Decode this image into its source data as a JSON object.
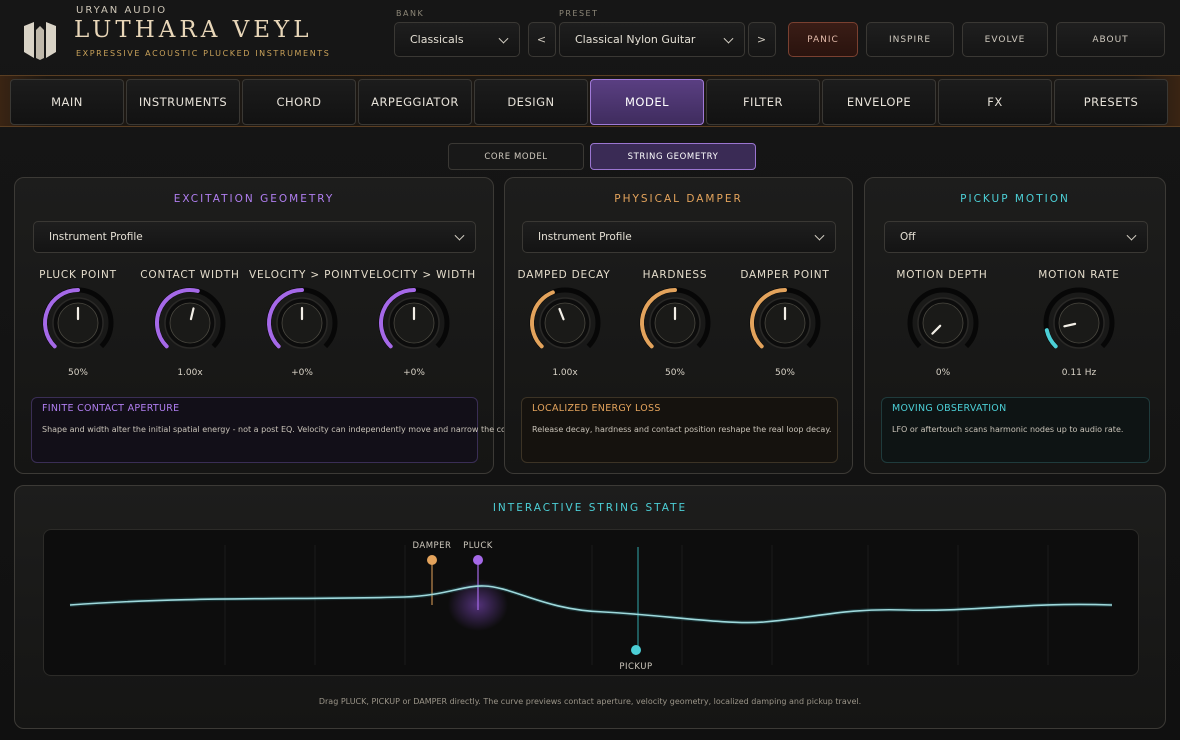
{
  "brand": {
    "company": "URYAN AUDIO",
    "product": "LUTHARA VEYL",
    "tagline": "EXPRESSIVE ACOUSTIC PLUCKED INSTRUMENTS"
  },
  "header": {
    "bank_label": "BANK",
    "bank_value": "Classicals",
    "preset_label": "PRESET",
    "preset_value": "Classical Nylon Guitar",
    "prev": "<",
    "next": ">",
    "panic": "PANIC",
    "inspire": "INSPIRE",
    "evolve": "EVOLVE",
    "about": "ABOUT"
  },
  "nav": {
    "tabs": [
      "MAIN",
      "INSTRUMENTS",
      "CHORD",
      "ARPEGGIATOR",
      "DESIGN",
      "MODEL",
      "FILTER",
      "ENVELOPE",
      "FX",
      "PRESETS"
    ],
    "active": "MODEL"
  },
  "subtabs": {
    "core": "CORE MODEL",
    "geometry": "STRING GEOMETRY",
    "active": "STRING GEOMETRY"
  },
  "colors": {
    "purple": "#a569e8",
    "orange": "#e3a35c",
    "teal": "#4ccfd6",
    "accent_active": "#5a3f82"
  },
  "excitation": {
    "title": "EXCITATION GEOMETRY",
    "profile": "Instrument Profile",
    "knobs": [
      {
        "label": "PLUCK POINT",
        "value": "50%",
        "level": 0.5
      },
      {
        "label": "CONTACT WIDTH",
        "value": "1.00x",
        "level": 0.55
      },
      {
        "label": "VELOCITY > POINT",
        "value": "+0%",
        "level": 0.5
      },
      {
        "label": "VELOCITY > WIDTH",
        "value": "+0%",
        "level": 0.5
      }
    ],
    "info_title": "FINITE CONTACT APERTURE",
    "info_text": "Shape and width alter the initial spatial energy - not a post EQ. Velocity can independently move and narrow the contact."
  },
  "damper": {
    "title": "PHYSICAL DAMPER",
    "profile": "Instrument Profile",
    "knobs": [
      {
        "label": "DAMPED DECAY",
        "value": "1.00x",
        "level": 0.42
      },
      {
        "label": "HARDNESS",
        "value": "50%",
        "level": 0.5
      },
      {
        "label": "DAMPER POINT",
        "value": "50%",
        "level": 0.5
      }
    ],
    "info_title": "LOCALIZED ENERGY LOSS",
    "info_text": "Release decay, hardness and contact position reshape the real loop decay."
  },
  "pickup": {
    "title": "PICKUP MOTION",
    "mode": "Off",
    "knobs": [
      {
        "label": "MOTION DEPTH",
        "value": "0%",
        "level": 0.0
      },
      {
        "label": "MOTION RATE",
        "value": "0.11 Hz",
        "level": 0.12
      }
    ],
    "info_title": "MOVING OBSERVATION",
    "info_text": "LFO or aftertouch scans harmonic nodes up to audio rate."
  },
  "string_state": {
    "title": "INTERACTIVE STRING STATE",
    "damper": "DAMPER",
    "pluck": "PLUCK",
    "pickup": "PICKUP",
    "hint": "Drag PLUCK, PICKUP or DAMPER directly. The curve previews contact aperture, velocity geometry, localized damping and pickup travel."
  }
}
